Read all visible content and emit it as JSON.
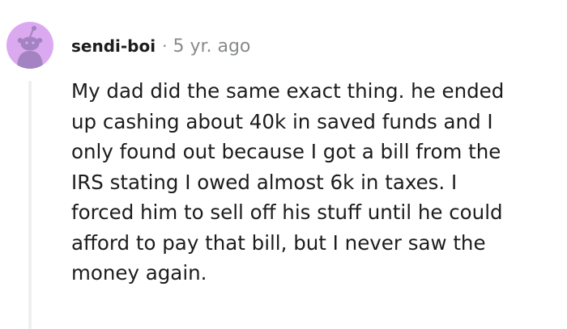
{
  "comment": {
    "author": "sendi-boi",
    "separator": "·",
    "timestamp": "5 yr. ago",
    "body_lines": [
      "My dad did the same exact thing. he ended",
      "up cashing about 40k in saved funds and I",
      "only found out because I got a bill from the",
      "IRS stating I owed almost 6k in taxes. I",
      "forced him to sell off his stuff until he could",
      "afford to pay that bill, but I never saw the",
      "money again."
    ],
    "avatar": {
      "icon": "snoo-avatar-icon",
      "background_color": "#dba9f0",
      "figure_color": "#a383c1"
    }
  }
}
